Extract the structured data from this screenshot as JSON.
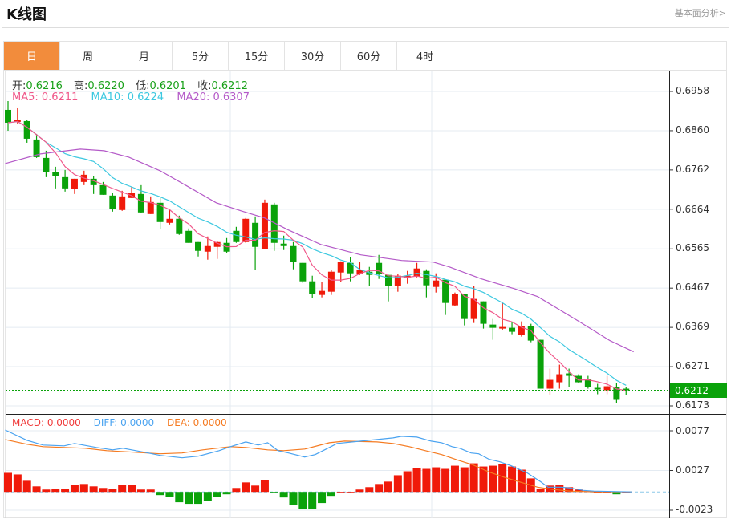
{
  "header": {
    "title": "K线图",
    "link": "基本面分析>"
  },
  "tabs": [
    {
      "label": "日",
      "active": true
    },
    {
      "label": "周"
    },
    {
      "label": "月"
    },
    {
      "label": "5分"
    },
    {
      "label": "15分"
    },
    {
      "label": "30分"
    },
    {
      "label": "60分"
    },
    {
      "label": "4时"
    }
  ],
  "ohlc_info": {
    "open_label": "开:",
    "open": "0.6216",
    "high_label": "高:",
    "high": "0.6220",
    "low_label": "低:",
    "low": "0.6201",
    "close_label": "收:",
    "close": "0.6212"
  },
  "ma_info": {
    "ma5": "MA5: 0.6211",
    "ma10": "MA10: 0.6224",
    "ma20": "MA20: 0.6307"
  },
  "macd_info": {
    "macd": "MACD: 0.0000",
    "diff": "DIFF: 0.0000",
    "dea": "DEA: 0.0000"
  },
  "colors": {
    "up": "#f01a0a",
    "down": "#0aa20a",
    "ma5": "#f0588a",
    "ma10": "#3cc8e0",
    "ma20": "#b45ac8",
    "diff": "#4aa3f0",
    "dea": "#f57a20",
    "accent": "#f28c3c"
  },
  "price_axis": [
    "0.6958",
    "0.6860",
    "0.6762",
    "0.6664",
    "0.6565",
    "0.6467",
    "0.6369",
    "0.6271",
    "0.6173"
  ],
  "current_price": "0.6212",
  "macd_axis": [
    "0.0077",
    "0.0027",
    "-0.0023"
  ],
  "chart_data": {
    "type": "candlestick",
    "candles": [
      [
        0.6912,
        0.6934,
        0.686,
        0.688
      ],
      [
        0.6882,
        0.6916,
        0.6876,
        0.6886
      ],
      [
        0.6884,
        0.6886,
        0.683,
        0.684
      ],
      [
        0.6838,
        0.6852,
        0.6792,
        0.6794
      ],
      [
        0.6792,
        0.681,
        0.6744,
        0.6756
      ],
      [
        0.6756,
        0.677,
        0.6716,
        0.6746
      ],
      [
        0.6744,
        0.6762,
        0.6708,
        0.6716
      ],
      [
        0.6714,
        0.674,
        0.6702,
        0.674
      ],
      [
        0.6732,
        0.676,
        0.6724,
        0.675
      ],
      [
        0.674,
        0.6746,
        0.6702,
        0.6724
      ],
      [
        0.6724,
        0.6732,
        0.67,
        0.67
      ],
      [
        0.6698,
        0.6704,
        0.6658,
        0.6664
      ],
      [
        0.6662,
        0.671,
        0.666,
        0.6696
      ],
      [
        0.6692,
        0.672,
        0.6692,
        0.6704
      ],
      [
        0.6702,
        0.6724,
        0.6654,
        0.6656
      ],
      [
        0.6652,
        0.6696,
        0.6652,
        0.6682
      ],
      [
        0.668,
        0.6692,
        0.6614,
        0.6632
      ],
      [
        0.663,
        0.6662,
        0.6626,
        0.664
      ],
      [
        0.664,
        0.6648,
        0.66,
        0.6602
      ],
      [
        0.661,
        0.6616,
        0.658,
        0.658
      ],
      [
        0.6582,
        0.6582,
        0.6546,
        0.656
      ],
      [
        0.6558,
        0.6596,
        0.6538,
        0.6572
      ],
      [
        0.657,
        0.6584,
        0.654,
        0.6582
      ],
      [
        0.658,
        0.6592,
        0.6554,
        0.6558
      ],
      [
        0.661,
        0.662,
        0.658,
        0.6582
      ],
      [
        0.6582,
        0.6642,
        0.658,
        0.664
      ],
      [
        0.663,
        0.6646,
        0.6512,
        0.657
      ],
      [
        0.6564,
        0.6688,
        0.6564,
        0.668
      ],
      [
        0.6676,
        0.668,
        0.656,
        0.658
      ],
      [
        0.6578,
        0.6598,
        0.6562,
        0.6572
      ],
      [
        0.6572,
        0.6582,
        0.6514,
        0.6532
      ],
      [
        0.653,
        0.653,
        0.648,
        0.6484
      ],
      [
        0.6484,
        0.6498,
        0.6442,
        0.6452
      ],
      [
        0.645,
        0.6482,
        0.6444,
        0.646
      ],
      [
        0.6458,
        0.6512,
        0.645,
        0.6508
      ],
      [
        0.6506,
        0.6534,
        0.6482,
        0.6532
      ],
      [
        0.653,
        0.6544,
        0.6484,
        0.6504
      ],
      [
        0.6502,
        0.6532,
        0.65,
        0.6512
      ],
      [
        0.6508,
        0.652,
        0.6472,
        0.65
      ],
      [
        0.653,
        0.655,
        0.649,
        0.6502
      ],
      [
        0.65,
        0.65,
        0.6434,
        0.6472
      ],
      [
        0.6472,
        0.6502,
        0.6458,
        0.6498
      ],
      [
        0.6492,
        0.651,
        0.6478,
        0.6498
      ],
      [
        0.6496,
        0.653,
        0.6494,
        0.6516
      ],
      [
        0.651,
        0.6514,
        0.6444,
        0.6474
      ],
      [
        0.647,
        0.6504,
        0.6456,
        0.6486
      ],
      [
        0.6488,
        0.6488,
        0.64,
        0.643
      ],
      [
        0.6424,
        0.6456,
        0.6422,
        0.6452
      ],
      [
        0.6452,
        0.6452,
        0.6374,
        0.639
      ],
      [
        0.639,
        0.6472,
        0.638,
        0.644
      ],
      [
        0.6434,
        0.6434,
        0.6366,
        0.6378
      ],
      [
        0.6376,
        0.639,
        0.6338,
        0.6368
      ],
      [
        0.6366,
        0.643,
        0.6362,
        0.637
      ],
      [
        0.6368,
        0.6382,
        0.6352,
        0.6358
      ],
      [
        0.635,
        0.6384,
        0.6346,
        0.6372
      ],
      [
        0.6372,
        0.6378,
        0.6332,
        0.6336
      ],
      [
        0.6338,
        0.6338,
        0.6216,
        0.6216
      ],
      [
        0.6216,
        0.6266,
        0.62,
        0.6238
      ],
      [
        0.6232,
        0.6276,
        0.6216,
        0.6252
      ],
      [
        0.6254,
        0.6266,
        0.622,
        0.6248
      ],
      [
        0.6248,
        0.6252,
        0.623,
        0.6232
      ],
      [
        0.624,
        0.6248,
        0.6216,
        0.622
      ],
      [
        0.6218,
        0.6228,
        0.6202,
        0.6214
      ],
      [
        0.6212,
        0.6248,
        0.6202,
        0.6222
      ],
      [
        0.622,
        0.623,
        0.618,
        0.6188
      ],
      [
        0.6216,
        0.622,
        0.6201,
        0.6212
      ]
    ],
    "ma20": [
      [
        -0.3,
        0.6778
      ],
      [
        3.4,
        0.6802
      ],
      [
        7.6,
        0.6814
      ],
      [
        10.1,
        0.681
      ],
      [
        12.7,
        0.6794
      ],
      [
        16,
        0.676
      ],
      [
        19.4,
        0.6714
      ],
      [
        21.9,
        0.668
      ],
      [
        24.5,
        0.666
      ],
      [
        27,
        0.6642
      ],
      [
        29.5,
        0.6612
      ],
      [
        32.9,
        0.6576
      ],
      [
        37.1,
        0.655
      ],
      [
        41.4,
        0.6536
      ],
      [
        44.7,
        0.6532
      ],
      [
        46.4,
        0.652
      ],
      [
        49.8,
        0.649
      ],
      [
        53.2,
        0.6466
      ],
      [
        55.7,
        0.6446
      ],
      [
        59.9,
        0.6386
      ],
      [
        63.3,
        0.6336
      ],
      [
        65.8,
        0.6308
      ]
    ],
    "macd_hist": [
      0.0024,
      0.0022,
      0.0014,
      0.0007,
      0.0003,
      0.0004,
      0.0004,
      0.0009,
      0.001,
      0.0007,
      0.0005,
      0.0004,
      0.0009,
      0.0009,
      0.0003,
      0.0003,
      -0.0004,
      -0.0006,
      -0.0013,
      -0.0015,
      -0.0015,
      -0.0011,
      -0.0006,
      -0.0003,
      0.0005,
      0.0012,
      0.0008,
      0.0015,
      -0.0001,
      -0.0007,
      -0.0016,
      -0.0022,
      -0.0022,
      -0.0014,
      -0.0005,
      0,
      0,
      0.0003,
      0.0006,
      0.001,
      0.0013,
      0.0021,
      0.0026,
      0.003,
      0.0029,
      0.0031,
      0.0029,
      0.0033,
      0.0031,
      0.0036,
      0.0032,
      0.0033,
      0.0035,
      0.0032,
      0.0028,
      0.0017,
      0.0004,
      0.0008,
      0.0009,
      0.0006,
      0.0003,
      0.0001,
      0,
      0,
      -0.0003,
      0
    ],
    "diff": [
      [
        -0.3,
        0.0078
      ],
      [
        2,
        0.0065
      ],
      [
        3.7,
        0.0059
      ],
      [
        5.9,
        0.0058
      ],
      [
        7,
        0.0061
      ],
      [
        9.3,
        0.0056
      ],
      [
        11,
        0.0053
      ],
      [
        12.1,
        0.0055
      ],
      [
        14.3,
        0.005
      ],
      [
        16,
        0.0046
      ],
      [
        18.3,
        0.0043
      ],
      [
        20,
        0.0045
      ],
      [
        22.2,
        0.0052
      ],
      [
        23.4,
        0.0057
      ],
      [
        25,
        0.0063
      ],
      [
        26.3,
        0.0059
      ],
      [
        27.3,
        0.0062
      ],
      [
        28.4,
        0.0052
      ],
      [
        29.5,
        0.0049
      ],
      [
        31.2,
        0.0044
      ],
      [
        32.3,
        0.0047
      ],
      [
        33.8,
        0.0056
      ],
      [
        34.6,
        0.0061
      ],
      [
        37.1,
        0.0064
      ],
      [
        40.5,
        0.0068
      ],
      [
        41.4,
        0.007
      ],
      [
        43,
        0.0069
      ],
      [
        44.5,
        0.0064
      ],
      [
        45.6,
        0.0062
      ],
      [
        46.7,
        0.0057
      ],
      [
        47.5,
        0.0055
      ],
      [
        48.7,
        0.0049
      ],
      [
        49.5,
        0.0048
      ],
      [
        50.6,
        0.0041
      ],
      [
        51.7,
        0.0038
      ],
      [
        52.9,
        0.0033
      ],
      [
        54.6,
        0.0024
      ],
      [
        56,
        0.0013
      ],
      [
        56.8,
        0.0006
      ],
      [
        58.2,
        0.0006
      ],
      [
        59.1,
        0.0005
      ],
      [
        60.5,
        0.0002
      ],
      [
        61.6,
        0.0001
      ],
      [
        65.6,
        0
      ]
    ],
    "dea": [
      [
        -0.3,
        0.0066
      ],
      [
        2,
        0.006
      ],
      [
        3.7,
        0.0057
      ],
      [
        8.1,
        0.0055
      ],
      [
        10.4,
        0.0052
      ],
      [
        13.2,
        0.005
      ],
      [
        16,
        0.0048
      ],
      [
        18.3,
        0.0049
      ],
      [
        20.5,
        0.0053
      ],
      [
        23.4,
        0.0057
      ],
      [
        25,
        0.0056
      ],
      [
        27.3,
        0.0053
      ],
      [
        29,
        0.0052
      ],
      [
        31.2,
        0.0054
      ],
      [
        33.8,
        0.0062
      ],
      [
        35.4,
        0.0064
      ],
      [
        38.8,
        0.0063
      ],
      [
        40.5,
        0.0061
      ],
      [
        42.2,
        0.0057
      ],
      [
        43.9,
        0.0052
      ],
      [
        45.6,
        0.0047
      ],
      [
        47.3,
        0.004
      ],
      [
        48.9,
        0.0034
      ],
      [
        50.6,
        0.0025
      ],
      [
        52.3,
        0.0018
      ],
      [
        54,
        0.0012
      ],
      [
        55.7,
        0.0006
      ],
      [
        57.4,
        0.0003
      ],
      [
        59.1,
        0.0001
      ],
      [
        61.9,
        0
      ],
      [
        65.6,
        0
      ]
    ],
    "price_range": [
      0.6173,
      0.6958
    ],
    "macd_range": [
      -0.0023,
      0.0077
    ]
  }
}
